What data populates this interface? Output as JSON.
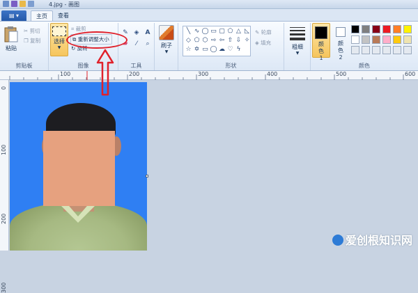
{
  "window": {
    "title": "4.jpg - 画图"
  },
  "tabs": {
    "file": "▤ ▾",
    "home": "主页",
    "view": "查看"
  },
  "clipboard": {
    "paste": "粘贴",
    "cut": "剪切",
    "copy": "复制",
    "label": "剪贴板"
  },
  "image": {
    "select": "选择",
    "crop": "裁剪",
    "resize": "重新调整大小",
    "rotate": "旋转",
    "label": "图像"
  },
  "tools": {
    "label": "工具"
  },
  "brushes": {
    "label": "刷子"
  },
  "shapes": {
    "outline": "轮廓",
    "fill": "填充",
    "label": "形状"
  },
  "size": {
    "label": "粗细"
  },
  "colors": {
    "color1": "颜色 1",
    "color2": "颜色 2",
    "label": "颜色",
    "palette_row1": [
      "#000000",
      "#7f7f7f",
      "#880015",
      "#ed1c24",
      "#ff7f27",
      "#fff200"
    ],
    "palette_row2": [
      "#ffffff",
      "#c3c3c3",
      "#b97a57",
      "#ffaec9",
      "#ffc90e",
      "#efe4b0"
    ]
  },
  "ruler": {
    "h_marks": [
      "100",
      "200",
      "300",
      "400",
      "500",
      "600"
    ],
    "v_marks": [
      "0",
      "100",
      "200",
      "300"
    ]
  },
  "watermark": "爱创根知识网",
  "accent": {
    "annotation": "#e0212b",
    "canvas_bg": "#2f7ff3"
  }
}
